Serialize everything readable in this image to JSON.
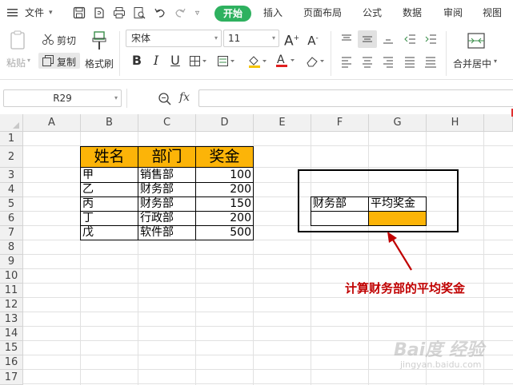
{
  "menubar": {
    "file_label": "文件",
    "tabs": [
      "开始",
      "插入",
      "页面布局",
      "公式",
      "数据",
      "审阅",
      "视图"
    ],
    "active_tab": "开始"
  },
  "ribbon": {
    "paste_label": "粘贴",
    "cut_label": "剪切",
    "copy_label": "复制",
    "format_painter_label": "格式刷",
    "font_name": "宋体",
    "font_size": "11",
    "merge_label": "合并居中"
  },
  "formula_bar": {
    "name_box": "R29",
    "fx_label": "fx",
    "formula": ""
  },
  "columns": [
    "A",
    "B",
    "C",
    "D",
    "E",
    "F",
    "G",
    "H"
  ],
  "rows": [
    "1",
    "2",
    "3",
    "4",
    "5",
    "6",
    "7",
    "8",
    "9",
    "10",
    "11",
    "12",
    "13",
    "14",
    "15",
    "16",
    "17"
  ],
  "table": {
    "headers": [
      "姓名",
      "部门",
      "奖金"
    ],
    "rows": [
      {
        "name": "甲",
        "dept": "销售部",
        "bonus": "100"
      },
      {
        "name": "乙",
        "dept": "财务部",
        "bonus": "200"
      },
      {
        "name": "丙",
        "dept": "财务部",
        "bonus": "150"
      },
      {
        "name": "丁",
        "dept": "行政部",
        "bonus": "200"
      },
      {
        "name": "戊",
        "dept": "软件部",
        "bonus": "500"
      }
    ]
  },
  "criteria": {
    "dept_label": "财务部",
    "avg_label": "平均奖金",
    "avg_value": ""
  },
  "annotation": "计算财务部的平均奖金",
  "watermark": {
    "brand": "Bai度 经验",
    "url": "jingyan.baidu.com"
  },
  "colors": {
    "active_tab": "#2eb15f",
    "highlight": "#fcb408",
    "annotation": "#c00000"
  }
}
